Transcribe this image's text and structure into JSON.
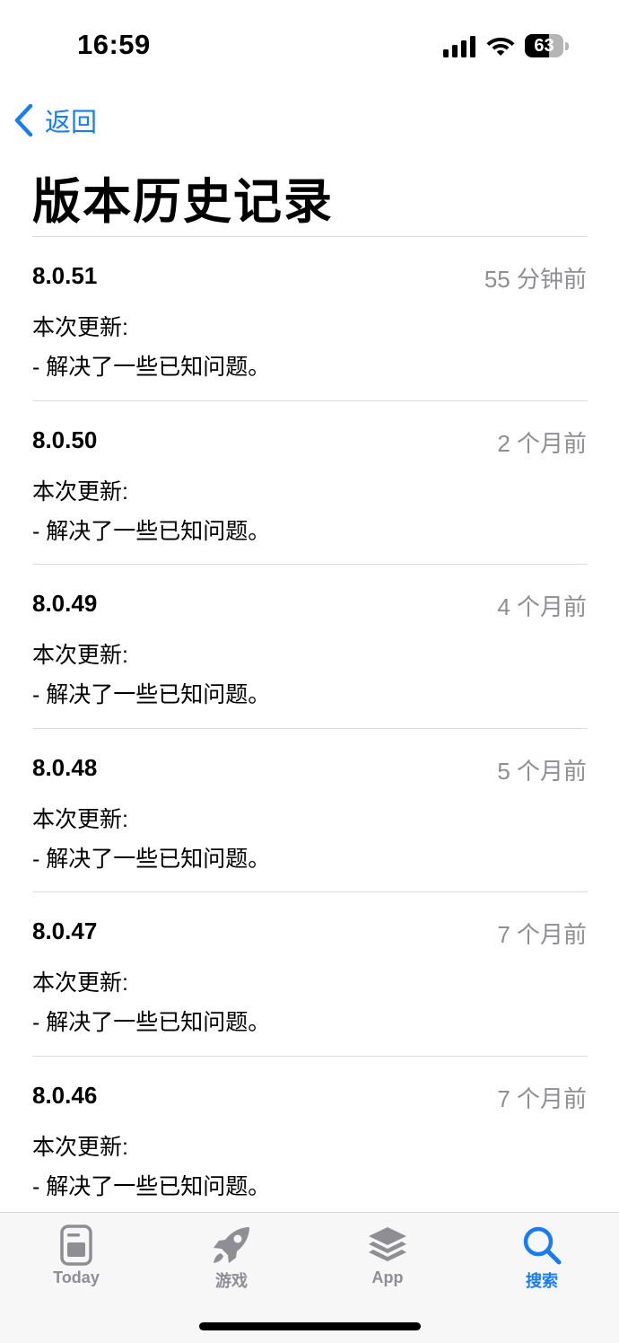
{
  "status_bar": {
    "time": "16:59",
    "battery_level": "63",
    "battery_fraction": 0.63,
    "icons": [
      "signal-icon",
      "wifi-icon",
      "battery-icon"
    ]
  },
  "nav": {
    "back_label": "返回",
    "back_icon": "chevron-left-icon",
    "accent_color": "#1a7cf5"
  },
  "page": {
    "title": "版本历史记录"
  },
  "versions": [
    {
      "version": "8.0.51",
      "time": "55 分钟前",
      "heading": "本次更新:",
      "line": "- 解决了一些已知问题。"
    },
    {
      "version": "8.0.50",
      "time": "2 个月前",
      "heading": "本次更新:",
      "line": "- 解决了一些已知问题。"
    },
    {
      "version": "8.0.49",
      "time": "4 个月前",
      "heading": "本次更新:",
      "line": "- 解决了一些已知问题。"
    },
    {
      "version": "8.0.48",
      "time": "5 个月前",
      "heading": "本次更新:",
      "line": "- 解决了一些已知问题。"
    },
    {
      "version": "8.0.47",
      "time": "7 个月前",
      "heading": "本次更新:",
      "line": "- 解决了一些已知问题。"
    },
    {
      "version": "8.0.46",
      "time": "7 个月前",
      "heading": "本次更新:",
      "line": "- 解决了一些已知问题。"
    }
  ],
  "tab_bar": {
    "tabs": [
      {
        "label": "Today",
        "icon": "today-icon",
        "active": false
      },
      {
        "label": "游戏",
        "icon": "rocket-icon",
        "active": false
      },
      {
        "label": "App",
        "icon": "app-stack-icon",
        "active": false
      },
      {
        "label": "搜索",
        "icon": "search-icon",
        "active": true
      }
    ],
    "active_color": "#1a7cf5",
    "inactive_color": "#8e8e93"
  }
}
